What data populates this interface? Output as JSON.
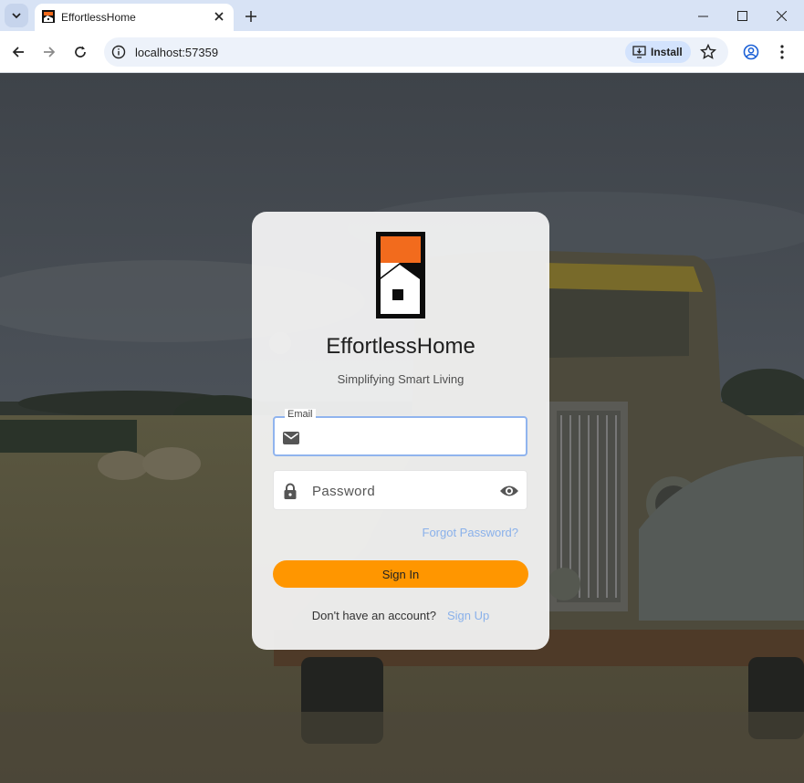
{
  "browser": {
    "tab_title": "EffortlessHome",
    "url": "localhost:57359",
    "install_label": "Install",
    "icons": [
      "tab-dropdown-icon",
      "close-icon",
      "plus-icon",
      "minimize-icon",
      "maximize-icon",
      "close-window-icon",
      "back-icon",
      "forward-icon",
      "reload-icon",
      "info-icon",
      "install-icon",
      "star-icon",
      "profile-icon",
      "menu-icon"
    ]
  },
  "login": {
    "app_name": "EffortlessHome",
    "tagline": "Simplifying Smart Living",
    "email_label": "Email",
    "email_value": "",
    "password_placeholder": "Password",
    "forgot_password": "Forgot Password?",
    "sign_in": "Sign In",
    "no_account": "Don't have an account?",
    "sign_up": "Sign Up"
  },
  "colors": {
    "accent": "#ff9600",
    "link": "#8ab1ea",
    "field_focus": "#90b4ee",
    "chrome_frame": "#d8e3f5"
  }
}
